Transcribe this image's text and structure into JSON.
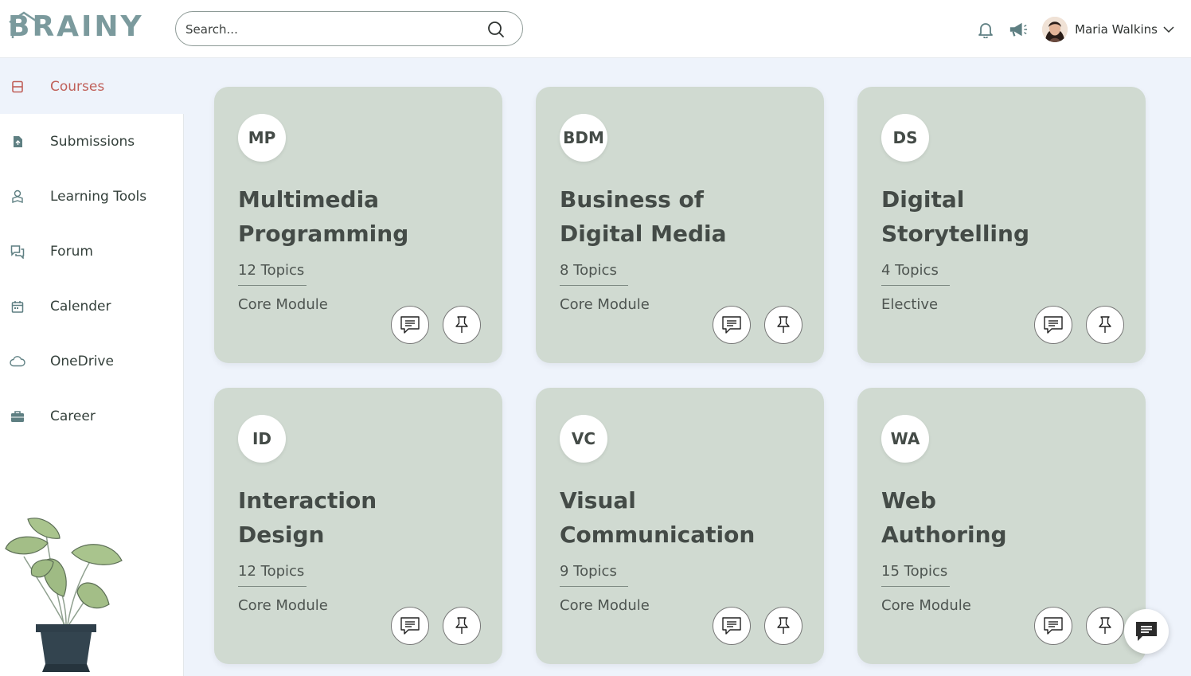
{
  "header": {
    "logo_text": "BRAINY",
    "search_placeholder": "Search...",
    "user_name": "Maria Walkins"
  },
  "sidebar": {
    "items": [
      {
        "label": "Courses",
        "icon": "courses-icon",
        "active": true
      },
      {
        "label": "Submissions",
        "icon": "submissions-icon",
        "active": false
      },
      {
        "label": "Learning Tools",
        "icon": "learning-tools-icon",
        "active": false
      },
      {
        "label": "Forum",
        "icon": "forum-icon",
        "active": false
      },
      {
        "label": "Calender",
        "icon": "calendar-icon",
        "active": false
      },
      {
        "label": "OneDrive",
        "icon": "cloud-icon",
        "active": false
      },
      {
        "label": "Career",
        "icon": "briefcase-icon",
        "active": false
      }
    ]
  },
  "courses": [
    {
      "badge": "MP",
      "title_line1": "Multimedia",
      "title_line2": "Programming",
      "topics": "12 Topics",
      "type": "Core Module"
    },
    {
      "badge": "BDM",
      "title_line1": "Business of",
      "title_line2": "Digital Media",
      "topics": "8 Topics",
      "type": "Core Module"
    },
    {
      "badge": "DS",
      "title_line1": "Digital",
      "title_line2": "Storytelling",
      "topics": "4 Topics",
      "type": "Elective"
    },
    {
      "badge": "ID",
      "title_line1": "Interaction",
      "title_line2": "Design",
      "topics": "12 Topics",
      "type": "Core Module"
    },
    {
      "badge": "VC",
      "title_line1": "Visual",
      "title_line2": "Communication",
      "topics": "9 Topics",
      "type": "Core Module"
    },
    {
      "badge": "WA",
      "title_line1": "Web",
      "title_line2": "Authoring",
      "topics": "15 Topics",
      "type": "Core Module"
    }
  ],
  "colors": {
    "accent": "#c0605a",
    "card_bg": "#d0dad1",
    "logo": "#7b9a9d",
    "page_bg": "#eef3fb"
  }
}
